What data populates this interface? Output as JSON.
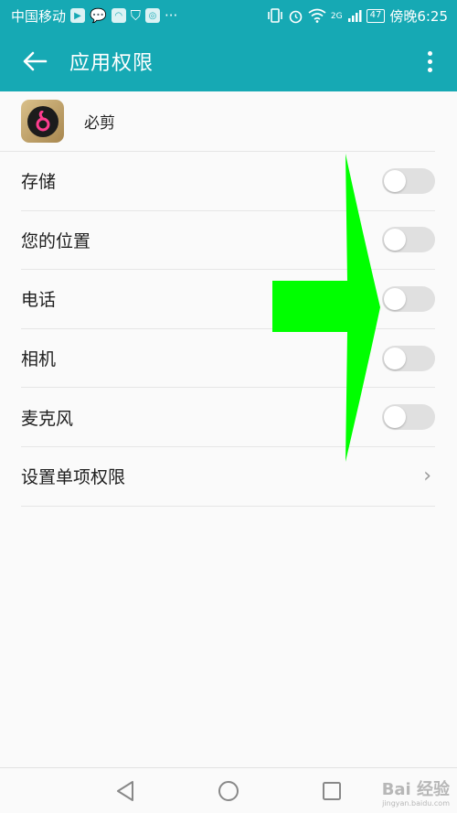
{
  "status_bar": {
    "carrier": "中国移动",
    "more": "···",
    "network": "2G",
    "battery": "47",
    "time": "傍晚6:25"
  },
  "header": {
    "title": "应用权限"
  },
  "app": {
    "name": "必剪"
  },
  "permissions": [
    {
      "label": "存储",
      "enabled": false
    },
    {
      "label": "您的位置",
      "enabled": false
    },
    {
      "label": "电话",
      "enabled": false
    },
    {
      "label": "相机",
      "enabled": false
    },
    {
      "label": "麦克风",
      "enabled": false
    }
  ],
  "single_permission": {
    "label": "设置单项权限"
  },
  "watermark": {
    "brand": "Bai 经验",
    "url": "jingyan.baidu.com"
  },
  "colors": {
    "accent": "#16a9b4",
    "arrow": "#00ff00"
  }
}
